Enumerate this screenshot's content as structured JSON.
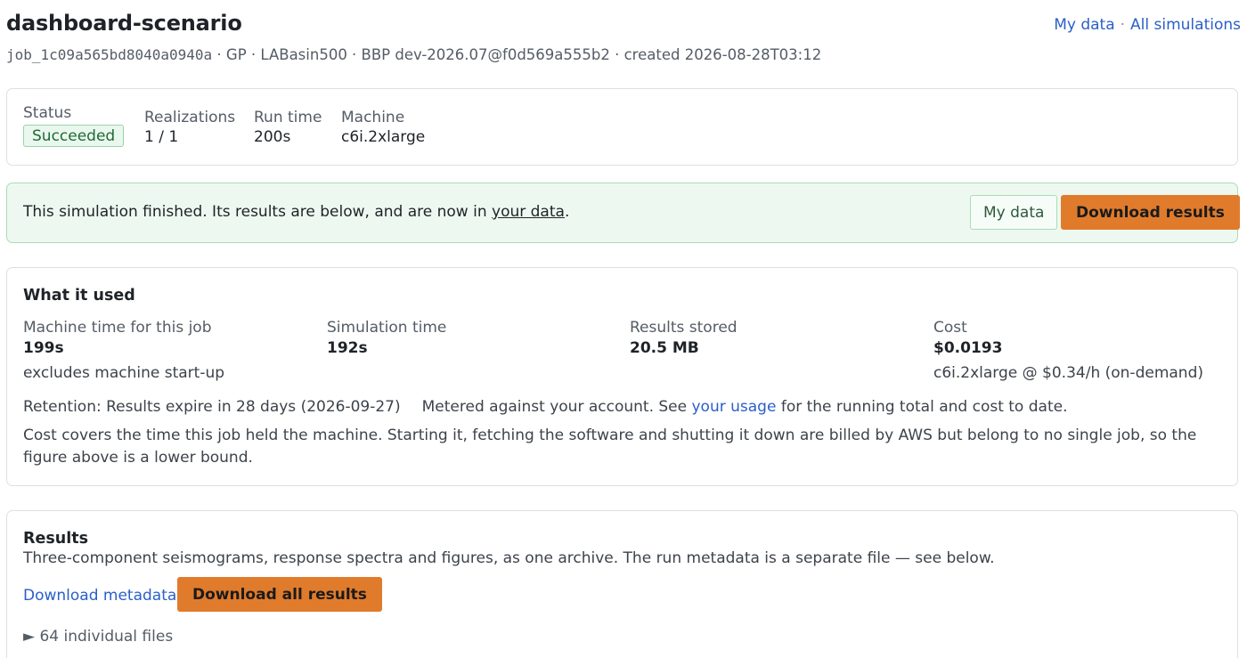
{
  "header": {
    "title": "dashboard-scenario",
    "job_id": "job_1c09a565bd8040a0940a",
    "meta": " · GP · LABasin500 · BBP dev-2026.07@f0d569a555b2 · created 2026-08-28T03:12",
    "links": {
      "my_data": "My data",
      "separator": "·",
      "all_simulations": "All simulations"
    }
  },
  "status_card": {
    "status_label": "Status",
    "status_value": "Succeeded",
    "realizations_label": "Realizations",
    "realizations_value": "1 / 1",
    "runtime_label": "Run time",
    "runtime_value": "200s",
    "machine_label": "Machine",
    "machine_value": "c6i.2xlarge"
  },
  "banner": {
    "text_before": "This simulation finished. Its results are below, and are now in ",
    "link": "your data",
    "text_after": ".",
    "my_data_button": "My data",
    "download_button": "Download results"
  },
  "usage": {
    "title": "What it used",
    "machine_time_label": "Machine time for this job",
    "machine_time_value": "199s",
    "machine_time_note": "excludes machine start-up",
    "simulation_time_label": "Simulation time",
    "simulation_time_value": "192s",
    "results_stored_label": "Results stored",
    "results_stored_value": "20.5 MB",
    "cost_label": "Cost",
    "cost_value": "$0.0193",
    "cost_note": "c6i.2xlarge @ $0.34/h (on-demand)",
    "retention": "Retention: Results expire in 28 days (2026-09-27)",
    "metered_before": "Metered against your account. See ",
    "metered_link": "your usage",
    "metered_after": " for the running total and cost to date.",
    "cost_explainer": "Cost covers the time this job held the machine. Starting it, fetching the software and shutting it down are billed by AWS but belong to no single job, so the figure above is a lower bound."
  },
  "results": {
    "title": "Results",
    "subtitle": "Three-component seismograms, response spectra and figures, as one archive. The run metadata is a separate file — see below.",
    "download_metadata": "Download metadata",
    "download_all": "Download all results",
    "files_toggle_icon": "►",
    "files_toggle": "64 individual files"
  },
  "colors": {
    "accent_orange": "#e07b2c",
    "link_blue": "#2a5fc8",
    "success_green": "#1e6b35",
    "banner_bg": "#edf9f0"
  }
}
